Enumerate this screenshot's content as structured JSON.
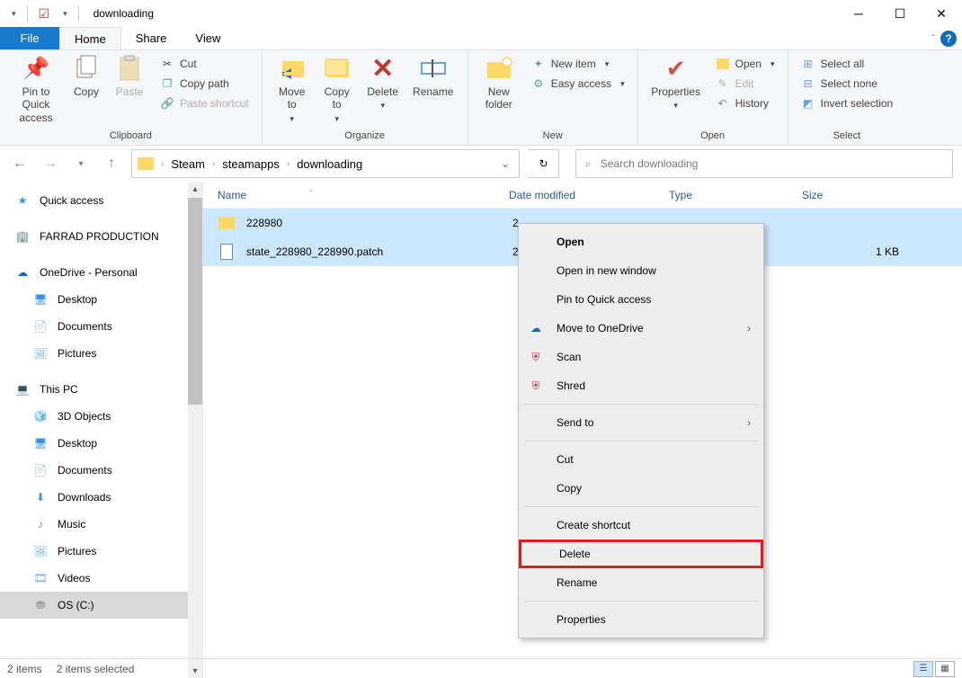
{
  "window": {
    "title": "downloading"
  },
  "tabs": {
    "file": "File",
    "home": "Home",
    "share": "Share",
    "view": "View"
  },
  "ribbon": {
    "clipboard": {
      "pin": "Pin to Quick\naccess",
      "copy": "Copy",
      "paste": "Paste",
      "cut": "Cut",
      "copypath": "Copy path",
      "pasteshortcut": "Paste shortcut",
      "label": "Clipboard"
    },
    "organize": {
      "moveto": "Move\nto",
      "copyto": "Copy\nto",
      "delete": "Delete",
      "rename": "Rename",
      "label": "Organize"
    },
    "new": {
      "newfolder": "New\nfolder",
      "newitem": "New item",
      "easyaccess": "Easy access",
      "label": "New"
    },
    "open": {
      "properties": "Properties",
      "open": "Open",
      "edit": "Edit",
      "history": "History",
      "label": "Open"
    },
    "select": {
      "selectall": "Select all",
      "selectnone": "Select none",
      "invert": "Invert selection",
      "label": "Select"
    }
  },
  "breadcrumb": {
    "a": "Steam",
    "b": "steamapps",
    "c": "downloading"
  },
  "search": {
    "placeholder": "Search downloading"
  },
  "nav": {
    "quick": "Quick access",
    "farrad": "FARRAD PRODUCTION",
    "onedrive": "OneDrive - Personal",
    "od_desktop": "Desktop",
    "od_documents": "Documents",
    "od_pictures": "Pictures",
    "thispc": "This PC",
    "pc_3d": "3D Objects",
    "pc_desktop": "Desktop",
    "pc_documents": "Documents",
    "pc_downloads": "Downloads",
    "pc_music": "Music",
    "pc_pictures": "Pictures",
    "pc_videos": "Videos",
    "pc_os": "OS (C:)"
  },
  "cols": {
    "name": "Name",
    "date": "Date modified",
    "type": "Type",
    "size": "Size"
  },
  "rows": [
    {
      "name": "228980",
      "date": "2",
      "type": "",
      "size": "",
      "icon": "folder"
    },
    {
      "name": "state_228980_228990.patch",
      "date": "2",
      "type": "",
      "size": "1 KB",
      "icon": "file"
    }
  ],
  "ctx": {
    "open": "Open",
    "openwin": "Open in new window",
    "pin": "Pin to Quick access",
    "onedrive": "Move to OneDrive",
    "scan": "Scan",
    "shred": "Shred",
    "sendto": "Send to",
    "cut": "Cut",
    "copy": "Copy",
    "shortcut": "Create shortcut",
    "delete": "Delete",
    "rename": "Rename",
    "properties": "Properties"
  },
  "status": {
    "count": "2 items",
    "sel": "2 items selected"
  }
}
